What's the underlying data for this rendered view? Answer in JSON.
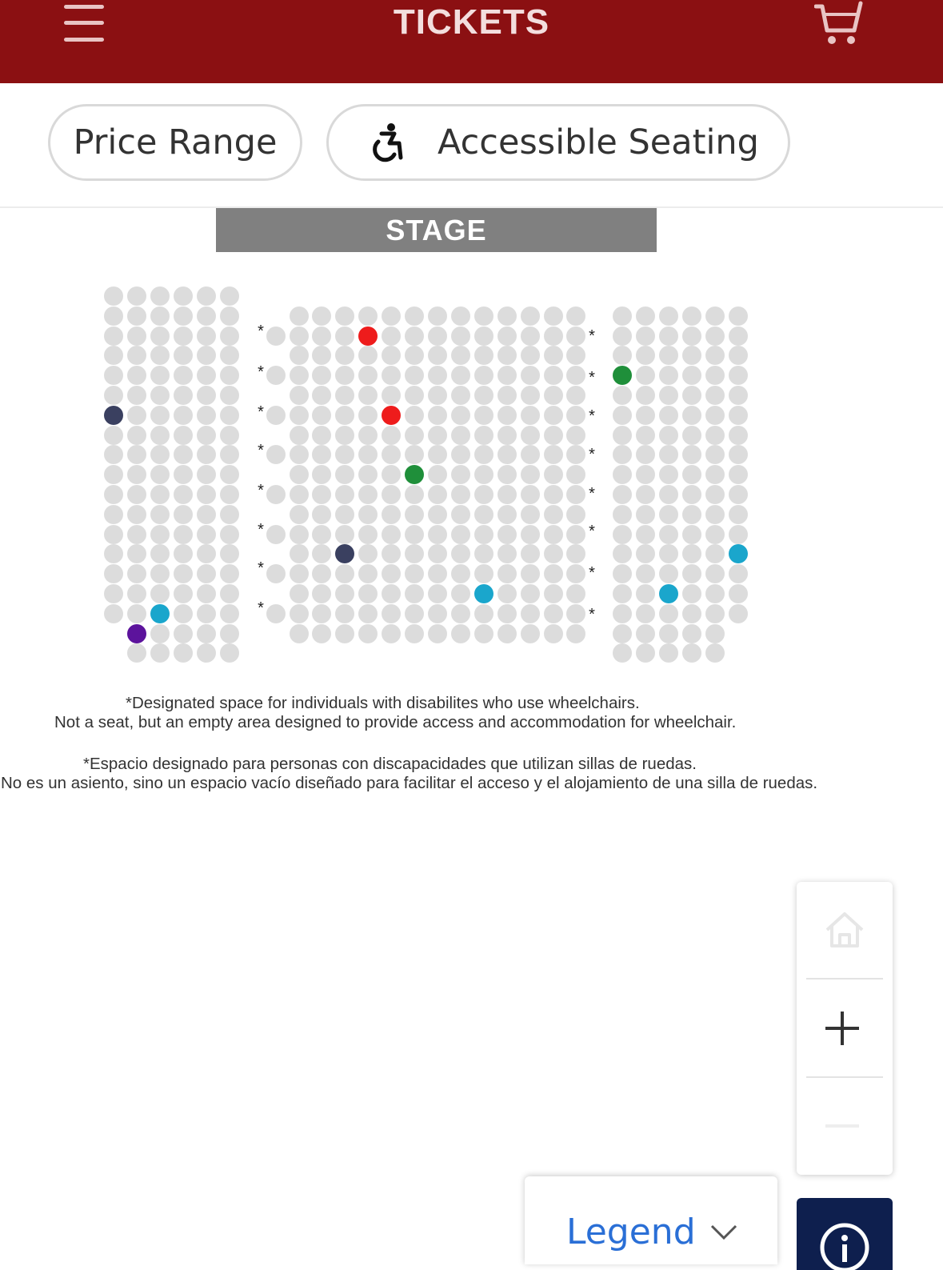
{
  "header": {
    "title": "TICKETS",
    "menu_icon": "hamburger-menu-icon",
    "cart_icon": "shopping-cart-icon",
    "background_color": "#8b1012"
  },
  "filters": {
    "price_label": "Price Range",
    "accessible_label": "Accessible Seating",
    "accessible_icon": "wheelchair-icon"
  },
  "stage": {
    "label": "STAGE"
  },
  "seatmap": {
    "seat_color_available": "#dcdcdc",
    "highlight_colors": {
      "red": "#ee1c1c",
      "green": "#1f8f3a",
      "navy": "#3a4060",
      "cyan": "#1aa6cc",
      "purple": "#5c139c"
    },
    "wheelchair_marker": "*"
  },
  "notes": {
    "en_line1": "*Designated space for individuals with disabilites who use wheelchairs.",
    "en_line2": "Not a seat, but an empty area designed to provide access and accommodation for wheelchair.",
    "es_line1": "*Espacio designado para personas con discapacidades que utilizan sillas de ruedas.",
    "es_line2": "No es un asiento, sino un espacio vacío diseñado para facilitar el acceso y el alojamiento de una silla de ruedas."
  },
  "zoom_controls": {
    "home_icon": "home-icon",
    "zoom_in_icon": "plus-icon",
    "zoom_out_icon": "minus-icon"
  },
  "legend": {
    "label": "Legend",
    "icon": "chevron-down-icon"
  },
  "info": {
    "icon": "info-icon"
  }
}
